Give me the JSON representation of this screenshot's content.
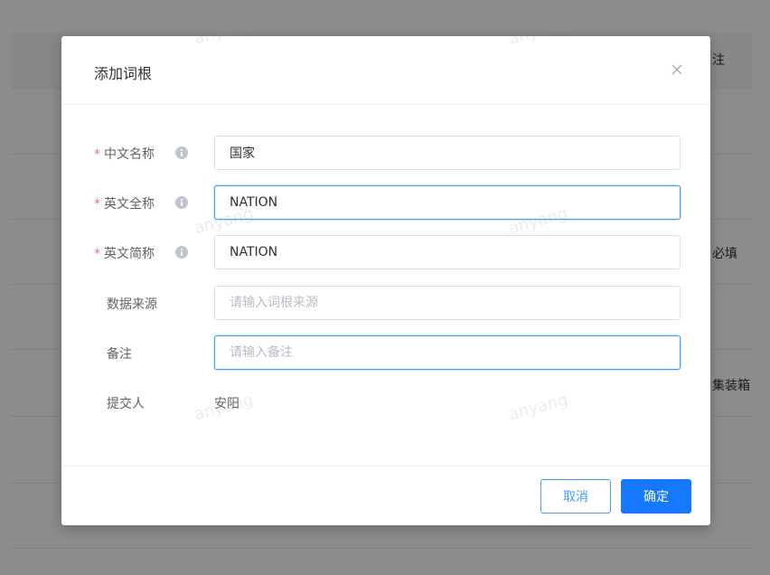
{
  "background": {
    "header_text": "注",
    "row_texts": [
      "必填",
      "集装箱"
    ]
  },
  "dialog": {
    "title": "添加词根",
    "close_icon": "close-icon",
    "fields": [
      {
        "label": "中文名称",
        "required": true,
        "has_info": true,
        "value": "国家",
        "placeholder": ""
      },
      {
        "label": "英文全称",
        "required": true,
        "has_info": true,
        "value": "NATION",
        "placeholder": "",
        "focused": true
      },
      {
        "label": "英文简称",
        "required": true,
        "has_info": true,
        "value": "NATION",
        "placeholder": ""
      },
      {
        "label": "数据来源",
        "required": false,
        "has_info": false,
        "value": "",
        "placeholder": "请输入词根来源"
      },
      {
        "label": "备注",
        "required": false,
        "has_info": false,
        "value": "",
        "placeholder": "请输入备注"
      }
    ],
    "submitter": {
      "label": "提交人",
      "value": "安阳"
    },
    "buttons": {
      "cancel": "取消",
      "confirm": "确定"
    }
  },
  "watermark": "anyang",
  "colors": {
    "primary": "#1677ff",
    "required": "#f56c6c",
    "focus_border": "#409eff"
  }
}
